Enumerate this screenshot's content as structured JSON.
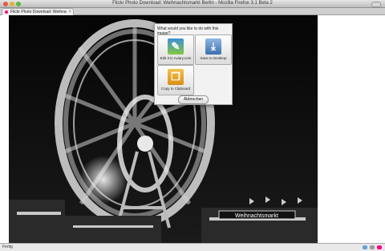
{
  "window": {
    "title": "Flickr Photo Download: Weihnachtsmarkt Berlin - Mozilla Firefox 3.1 Beta 2"
  },
  "tab": {
    "label": "Flickr Photo Download: Weihnachtsmarkt Berlin"
  },
  "status": {
    "text": "Fertig"
  },
  "dialog": {
    "question": "What would you like to do with this image?",
    "options": [
      {
        "label": "Edit it in Aviary.com",
        "icon": "aviary-icon"
      },
      {
        "label": "Save to Desktop",
        "icon": "desktop-icon"
      },
      {
        "label": "Copy to Clipboard",
        "icon": "clipboard-icon"
      }
    ],
    "cancel_label": "Abbrechen"
  },
  "photo": {
    "sign_text": "Weihnachtsmarkt"
  },
  "colors": {
    "flickr_pink": "#ff0084",
    "aviary": "#3e8fd6",
    "desktop": "#3c6fb0",
    "clipboard": "#f3c04a"
  }
}
